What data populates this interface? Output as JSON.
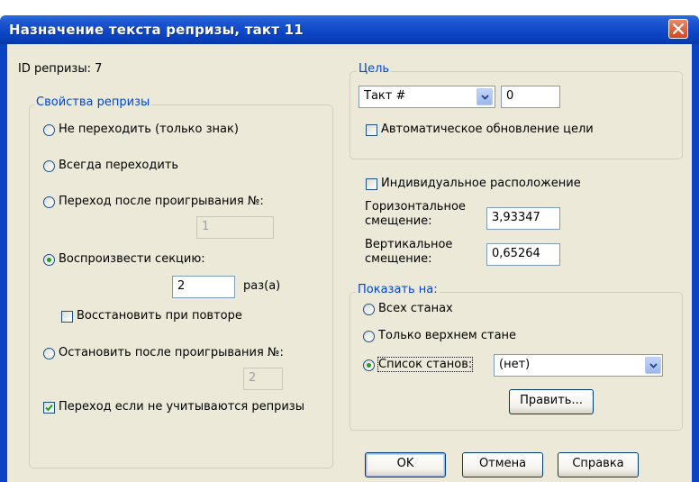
{
  "window": {
    "title": "Назначение текста репризы, такт 11"
  },
  "repeat_id": {
    "label": "ID репризы:",
    "value": "7"
  },
  "properties": {
    "legend": "Свойства репризы",
    "options": [
      {
        "label": "Не переходить (только знак)",
        "selected": false
      },
      {
        "label": "Всегда переходить",
        "selected": false
      },
      {
        "label": "Переход после проигрывания №:",
        "selected": false,
        "value": "1"
      },
      {
        "label": "Воспроизвести секцию:",
        "selected": true,
        "value": "2",
        "unit": "раз(а)"
      },
      {
        "label": "Остановить после проигрывания №:",
        "selected": false,
        "value": "2"
      }
    ],
    "restore_checkbox": {
      "label": "Восстановить при повторе",
      "checked": false
    },
    "jump_checkbox": {
      "label": "Переход если не учитываются репризы",
      "checked": true
    }
  },
  "target": {
    "legend": "Цель",
    "type_select": "Такт #",
    "value": "0",
    "auto_update": {
      "label": "Автоматическое обновление цели",
      "checked": false
    }
  },
  "placement": {
    "individual": {
      "label": "Индивидуальное расположение",
      "checked": false
    },
    "h_offset": {
      "label_line1": "Горизонтальное",
      "label_line2": "смещение:",
      "value": "3,93347"
    },
    "v_offset": {
      "label_line1": "Вертикальное",
      "label_line2": "смещение:",
      "value": "0,65264"
    }
  },
  "show_on": {
    "legend": "Показать на:",
    "options": [
      {
        "label": "Всех станах",
        "selected": false
      },
      {
        "label": "Только верхнем стане",
        "selected": false
      },
      {
        "label": "Список станов:",
        "selected": true
      }
    ],
    "staff_list_select": "(нет)",
    "edit_button": "Править..."
  },
  "buttons": {
    "ok": "OK",
    "cancel": "Отмена",
    "help": "Справка"
  },
  "colors": {
    "title_bar": "#0a43c2",
    "accent_legend": "#0046d5",
    "check_green": "#21a121",
    "close_red": "#d2451e"
  }
}
